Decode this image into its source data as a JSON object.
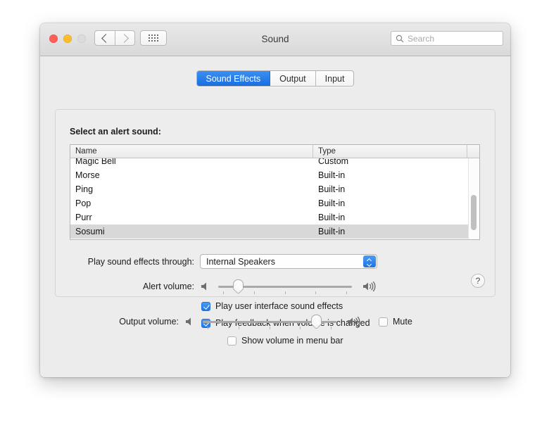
{
  "window": {
    "title": "Sound",
    "traffic": {
      "close": "close-button",
      "minimize": "minimize-button",
      "zoom": "zoom-button"
    },
    "nav": {
      "back": "back-button",
      "forward": "forward-button",
      "grid": "show-all-button"
    }
  },
  "search": {
    "placeholder": "Search",
    "value": "",
    "icon": "search-icon"
  },
  "tabs": [
    {
      "label": "Sound Effects",
      "active": true
    },
    {
      "label": "Output",
      "active": false
    },
    {
      "label": "Input",
      "active": false
    }
  ],
  "sound_effects": {
    "alert_heading": "Select an alert sound:",
    "table": {
      "columns": [
        "Name",
        "Type"
      ],
      "rows": [
        {
          "name": "Magic Bell",
          "type": "Custom",
          "selected": false
        },
        {
          "name": "Morse",
          "type": "Built-in",
          "selected": false
        },
        {
          "name": "Ping",
          "type": "Built-in",
          "selected": false
        },
        {
          "name": "Pop",
          "type": "Built-in",
          "selected": false
        },
        {
          "name": "Purr",
          "type": "Built-in",
          "selected": false
        },
        {
          "name": "Sosumi",
          "type": "Built-in",
          "selected": true
        }
      ],
      "scroll_position": "near-bottom"
    },
    "output_device": {
      "label": "Play sound effects through:",
      "value": "Internal Speakers"
    },
    "alert_volume": {
      "label": "Alert volume:",
      "value_percent": 12,
      "mute_icon": "speaker-muted-icon",
      "max_icon": "speaker-loud-icon",
      "tick_count": 5
    },
    "checkbox_ui_sounds": {
      "label": "Play user interface sound effects",
      "checked": true
    },
    "checkbox_feedback": {
      "label": "Play feedback when volume is changed",
      "checked": true
    },
    "help_button": {
      "label": "?"
    }
  },
  "bottom": {
    "output_volume": {
      "label": "Output volume:",
      "value_percent": 88,
      "mute_icon": "speaker-muted-icon",
      "max_icon": "speaker-loud-icon",
      "tick_count": 5
    },
    "checkbox_mute": {
      "label": "Mute",
      "checked": false
    },
    "checkbox_menubar": {
      "label": "Show volume in menu bar",
      "checked": false
    }
  },
  "colors": {
    "accent": "#1f72e3",
    "selection": "#d8d8d8",
    "window_bg": "#ececec"
  }
}
